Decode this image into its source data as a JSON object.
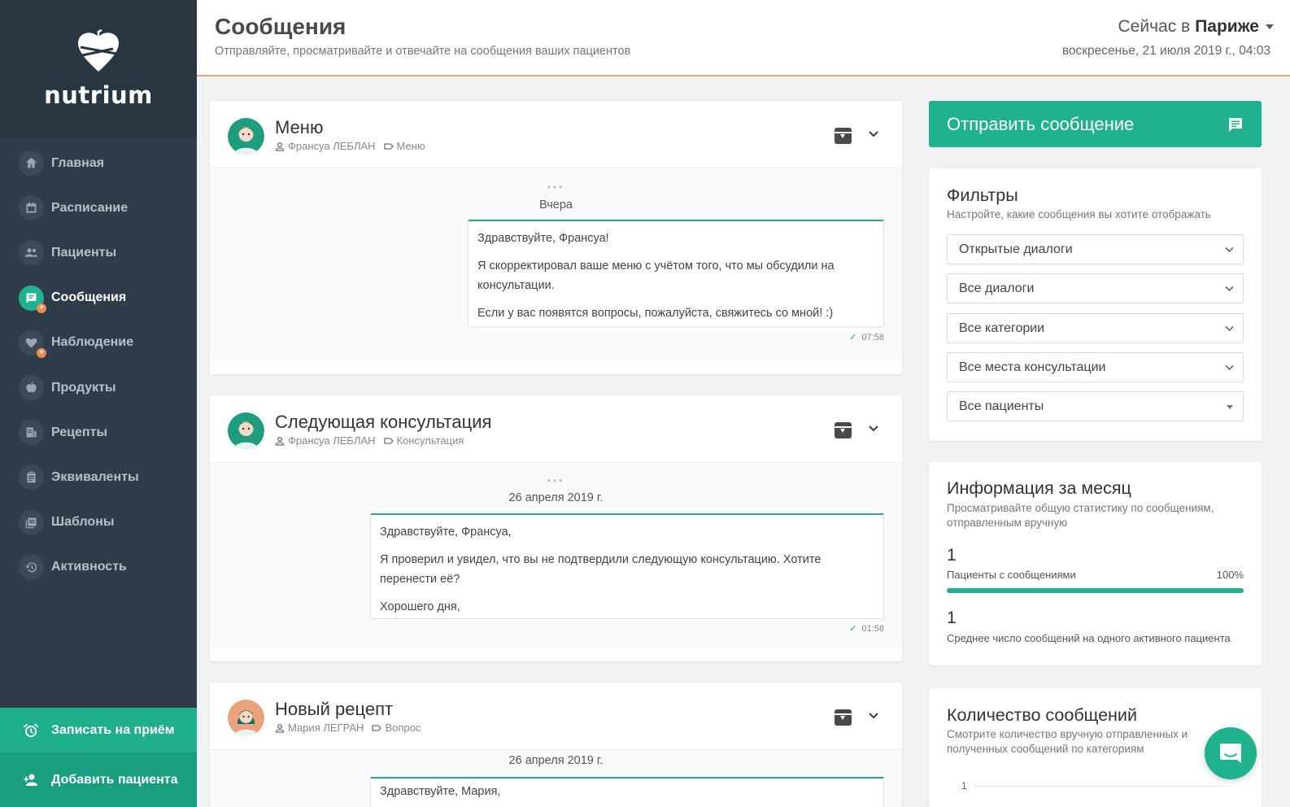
{
  "brand": {
    "name": "nutrium"
  },
  "sidebar": {
    "items": [
      {
        "label": "Главная",
        "icon": "home-icon"
      },
      {
        "label": "Расписание",
        "icon": "calendar-icon"
      },
      {
        "label": "Пациенты",
        "icon": "people-icon"
      },
      {
        "label": "Сообщения",
        "icon": "message-icon",
        "active": true,
        "badge": "+"
      },
      {
        "label": "Наблюдение",
        "icon": "heart-icon",
        "badge": "+"
      },
      {
        "label": "Продукты",
        "icon": "apple-icon"
      },
      {
        "label": "Рецепты",
        "icon": "recipe-icon"
      },
      {
        "label": "Эквиваленты",
        "icon": "clipboard-icon"
      },
      {
        "label": "Шаблоны",
        "icon": "templates-icon"
      },
      {
        "label": "Активность",
        "icon": "history-icon"
      }
    ],
    "cta_appointment": "Записать на приём",
    "cta_add_patient": "Добавить пациента"
  },
  "header": {
    "title": "Сообщения",
    "subtitle": "Отправляйте, просматривайте и отвечайте на сообщения ваших пациентов",
    "tz_prefix": "Сейчас в",
    "tz_city": "Париже",
    "datetime": "воскресенье, 21 июля 2019 г., 04:03"
  },
  "conversations": [
    {
      "title": "Меню",
      "patient": "Франсуа ЛЕБЛАН",
      "category": "Меню",
      "day": "Вчера",
      "message": [
        "Здравствуйте, Франсуа!",
        "Я скорректировал ваше меню с учётом того, что мы обсудили на консультации.",
        "Если у вас появятся вопросы, пожалуйста, свяжитесь со мной! :)"
      ],
      "time": "07:58"
    },
    {
      "title": "Следующая консультация",
      "patient": "Франсуа ЛЕБЛАН",
      "category": "Консультация",
      "day": "26 апреля 2019 г.",
      "message": [
        "Здравствуйте, Франсуа,",
        "Я проверил и увидел, что вы не подтвердили следующую консультацию. Хотите перенести её?",
        "Хорошего дня,"
      ],
      "time": "01:58"
    },
    {
      "title": "Новый рецепт",
      "patient": "Мария ЛЕГРАН",
      "category": "Вопрос",
      "day": "26 апреля 2019 г.",
      "message": [
        "Здравствуйте, Мария,"
      ]
    }
  ],
  "send_button": "Отправить сообщение",
  "filters": {
    "title": "Фильтры",
    "desc": "Настройте, какие сообщения вы хотите отображать",
    "selects": [
      "Открытые диалоги",
      "Все диалоги",
      "Все категории",
      "Все места консультации",
      "Все пациенты"
    ]
  },
  "monthly": {
    "title": "Информация за месяц",
    "desc": "Просматривайте общую статистику по сообщениям, отправленным вручную",
    "stat1_value": "1",
    "stat1_label": "Пациенты с сообщениями",
    "stat1_pct": "100%",
    "stat1_progress": 1.0,
    "stat2_value": "1",
    "stat2_label": "Среднее число сообщений на одного активного пациента"
  },
  "counts": {
    "title": "Количество сообщений",
    "desc": "Смотрите количество вручную отправленных и полученных сообщений по категориям",
    "axis_tick": "1"
  },
  "colors": {
    "accent": "#20b18f",
    "sidebar": "#2e3d49",
    "header_border": "#f0a47c",
    "badge": "#f08a51"
  }
}
